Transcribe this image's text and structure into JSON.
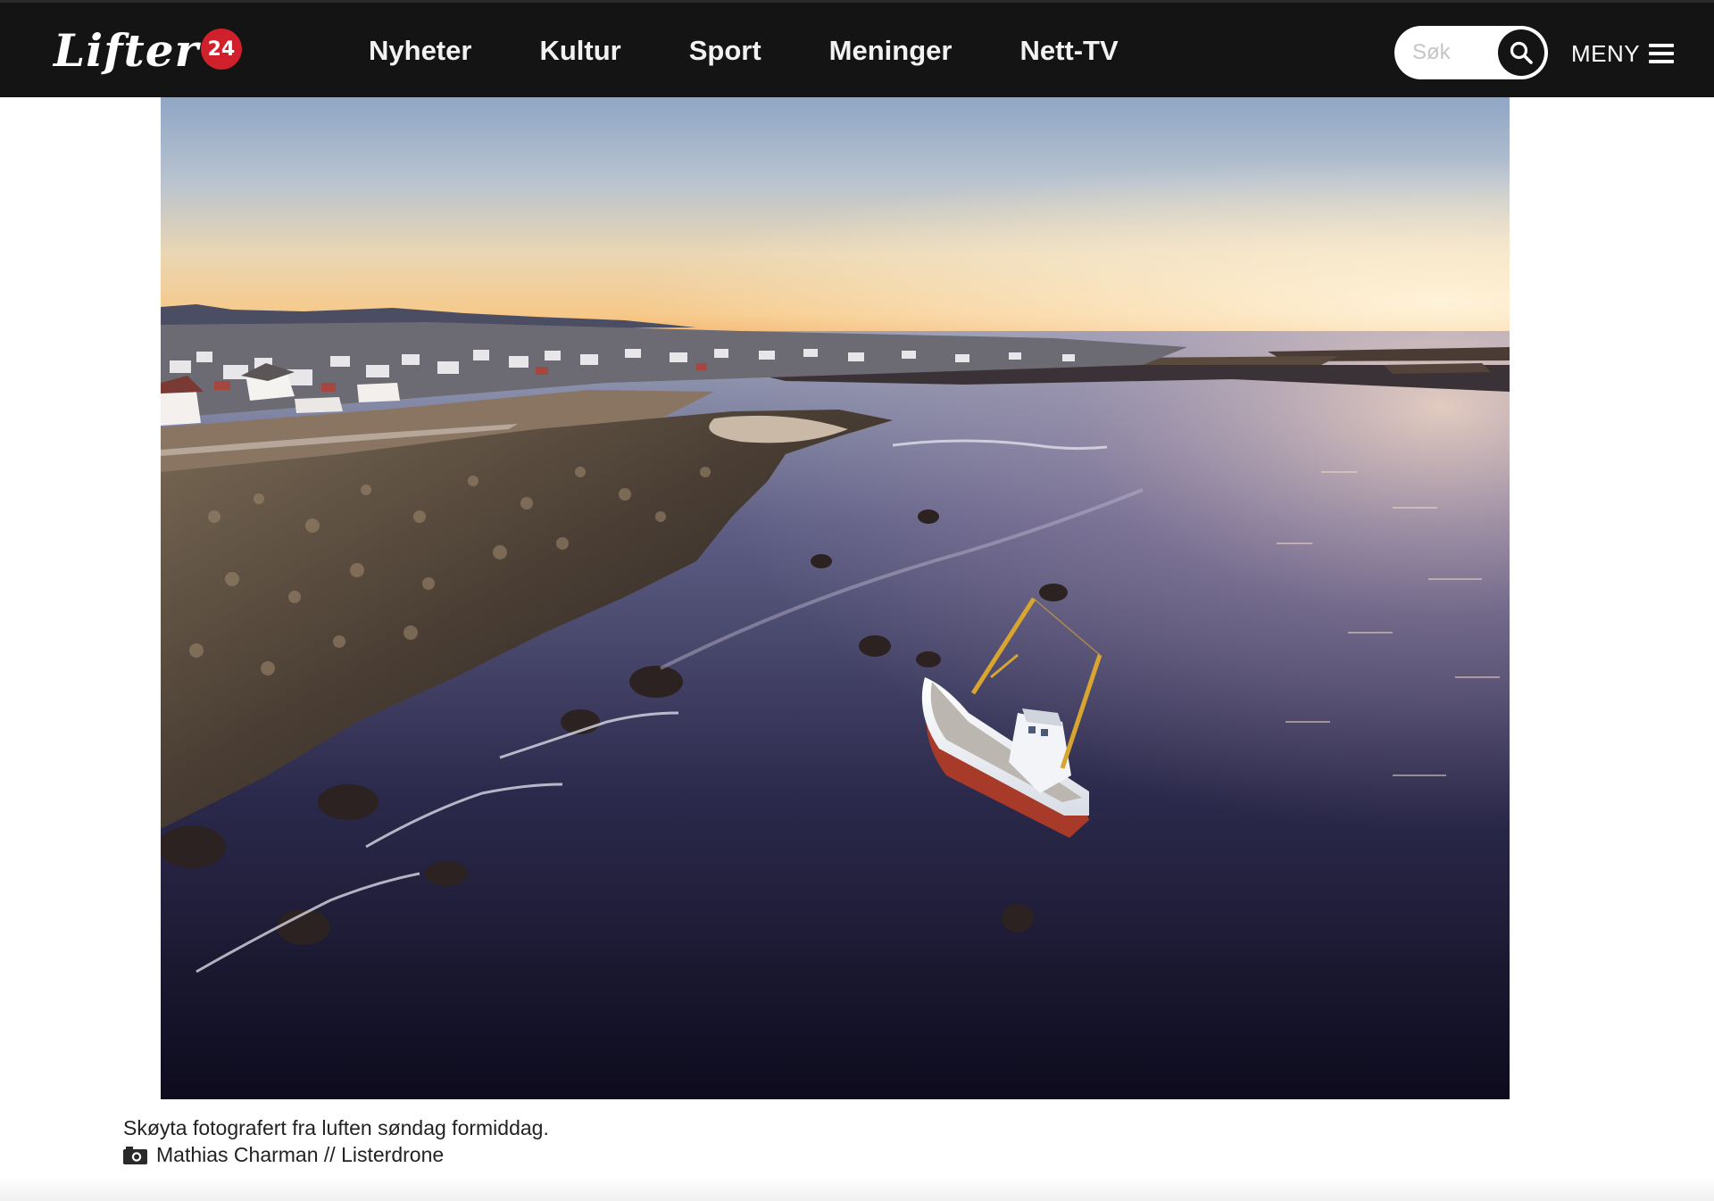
{
  "header": {
    "logo_text": "Lifter",
    "logo_badge": "24",
    "nav": [
      {
        "label": "Nyheter"
      },
      {
        "label": "Kultur"
      },
      {
        "label": "Sport"
      },
      {
        "label": "Meninger"
      },
      {
        "label": "Nett-TV"
      }
    ],
    "search": {
      "placeholder": "Søk",
      "value": "",
      "icon": "search-icon"
    },
    "menu": {
      "label": "MENY",
      "icon": "hamburger-icon"
    }
  },
  "article": {
    "image": {
      "subject": "aerial photo of a fishing boat near a rocky shore at sunset"
    },
    "caption": "Skøyta fotografert fra luften søndag formiddag.",
    "credit": {
      "icon": "camera-icon",
      "text": "Mathias Charman // Listerdrone"
    }
  },
  "colors": {
    "header_bg": "#141414",
    "logo_badge": "#d0202c",
    "nav_text": "#f2f2f2",
    "page_bg": "#ffffff"
  }
}
